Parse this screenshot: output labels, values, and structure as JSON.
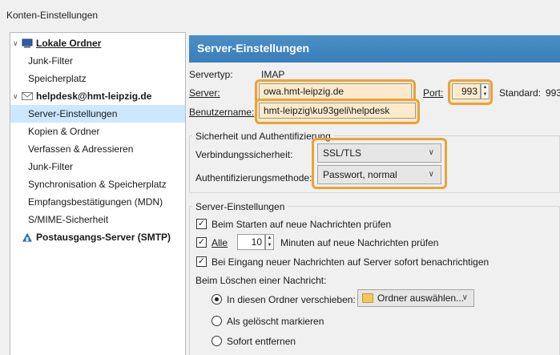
{
  "window": {
    "title": "Konten-Einstellungen"
  },
  "tree": {
    "local_folders": "Lokale Ordner",
    "local_items": [
      "Junk-Filter",
      "Speicherplatz"
    ],
    "account": "helpdesk@hmt-leipzig.de",
    "account_items": [
      "Server-Einstellungen",
      "Kopien & Ordner",
      "Verfassen & Adressieren",
      "Junk-Filter",
      "Synchronisation & Speicherplatz",
      "Empfangsbestätigungen (MDN)",
      "S/MIME-Sicherheit"
    ],
    "smtp": "Postausgangs-Server (SMTP)"
  },
  "pane": {
    "title": "Server-Einstellungen",
    "server_type_label": "Servertyp:",
    "server_type_value": "IMAP",
    "server_label": "Server:",
    "server_value": "owa.hmt-leipzig.de",
    "port_label": "Port:",
    "port_value": "993",
    "standard_label": "Standard:",
    "standard_value": "993",
    "username_label": "Benutzername:",
    "username_value": "hmt-leipzig\\ku93geli\\helpdesk",
    "security": {
      "title": "Sicherheit und Authentifizierung",
      "conn_label": "Verbindungssicherheit:",
      "conn_value": "SSL/TLS",
      "auth_label": "Authentifizierungsmethode:",
      "auth_value": "Passwort, normal"
    },
    "settings": {
      "title": "Server-Einstellungen",
      "check_startup": "Beim Starten auf neue Nachrichten prüfen",
      "every_label": "Alle",
      "every_value": "10",
      "minutes_label": "Minuten auf neue Nachrichten prüfen",
      "notify": "Bei Eingang neuer Nachrichten auf Server sofort benachrichtigen",
      "on_delete": "Beim Löschen einer Nachricht:",
      "move_option": "In diesen Ordner verschieben:",
      "folder_button": "Ordner auswählen...",
      "mark_option": "Als gelöscht markieren",
      "remove_option": "Sofort entfernen"
    }
  },
  "colors": {
    "highlight": "#e8a33b",
    "banner": "#3f86bf",
    "selection": "#cce8ff"
  }
}
